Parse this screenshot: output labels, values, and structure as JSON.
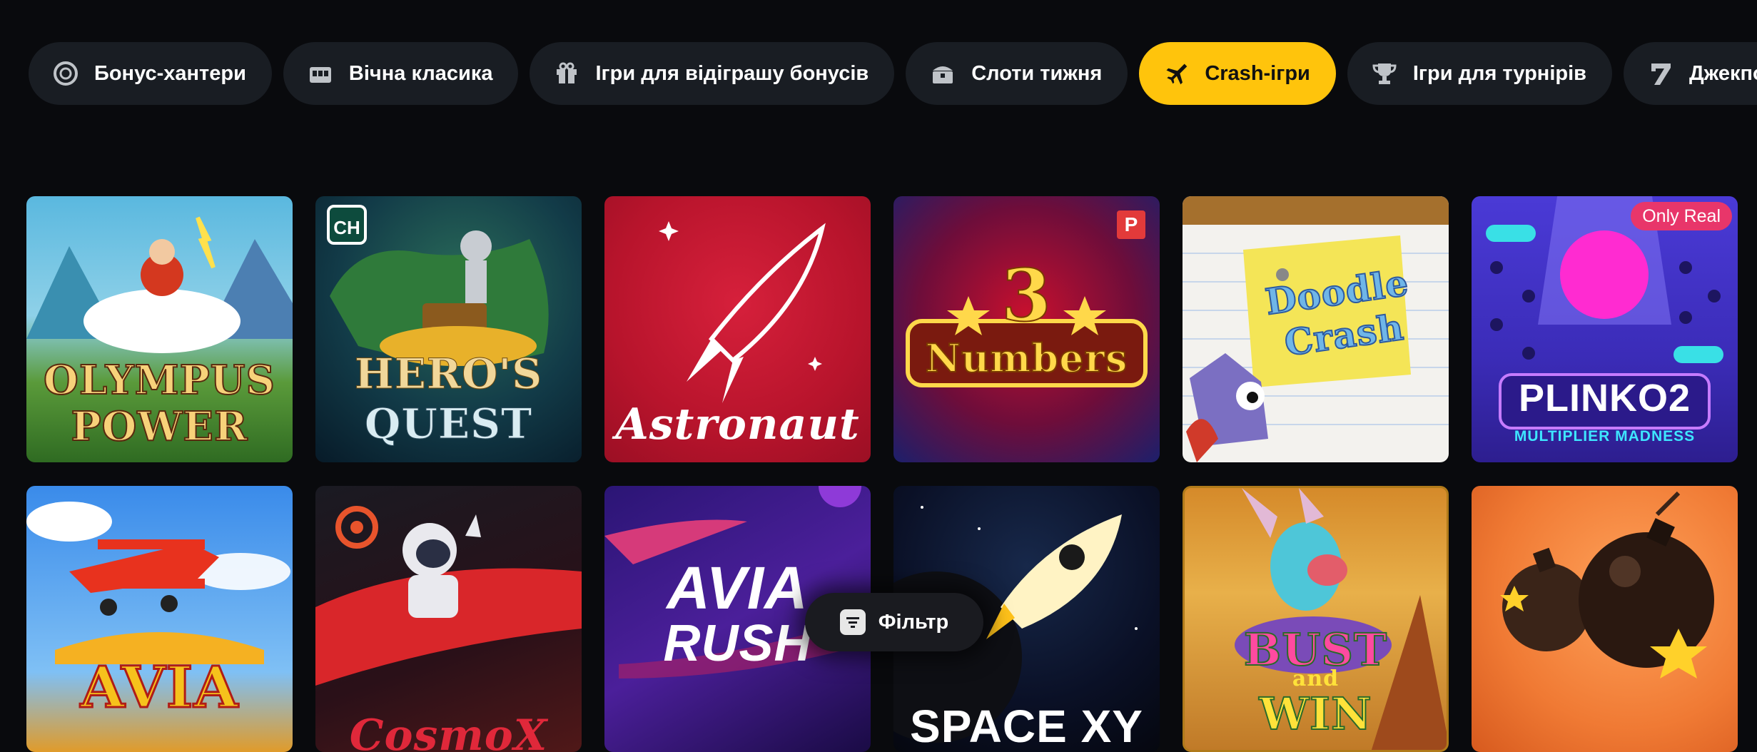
{
  "tabs": [
    {
      "label": "Бонус-хантери",
      "icon": "poker-chip-icon",
      "active": false
    },
    {
      "label": "Вічна класика",
      "icon": "slot-machine-icon",
      "active": false
    },
    {
      "label": "Ігри для відіграшу бонусів",
      "icon": "gift-icon",
      "active": false
    },
    {
      "label": "Слоти тижня",
      "icon": "treasure-chest-icon",
      "active": false
    },
    {
      "label": "Crash-ігри",
      "icon": "airplane-icon",
      "active": true
    },
    {
      "label": "Ігри для турнірів",
      "icon": "trophy-icon",
      "active": false
    },
    {
      "label": "Джекпоти",
      "icon": "seven-icon",
      "active": false
    }
  ],
  "colors": {
    "background": "#090a0d",
    "tab_bg": "#191d23",
    "accent": "#ffc40c"
  },
  "games": [
    {
      "title_line1": "OLYMPUS",
      "title_line2": "POWER"
    },
    {
      "title_line1": "HERO'S",
      "title_line2": "QUEST",
      "logo": "CH"
    },
    {
      "title_line1": "Astronaut"
    },
    {
      "title_line1": "3",
      "title_line2": "Numbers",
      "badge": "P"
    },
    {
      "title_line1": "Doodle",
      "title_line2": "Crash"
    },
    {
      "title_line1": "PLINKO2",
      "title_line2": "MULTIPLIER MADNESS",
      "badge": "Only Real"
    },
    {
      "title_line1": "AVIA"
    },
    {
      "title_line1": "CosmoX"
    },
    {
      "title_line1": "AVIA",
      "title_line2": "RUSH"
    },
    {
      "title_line1": "SPACE XY"
    },
    {
      "title_line1": "BUST",
      "title_line2": "and",
      "title_line3": "WIN"
    },
    {
      "title_line1": ""
    }
  ],
  "filter": {
    "label": "Фільтр"
  }
}
